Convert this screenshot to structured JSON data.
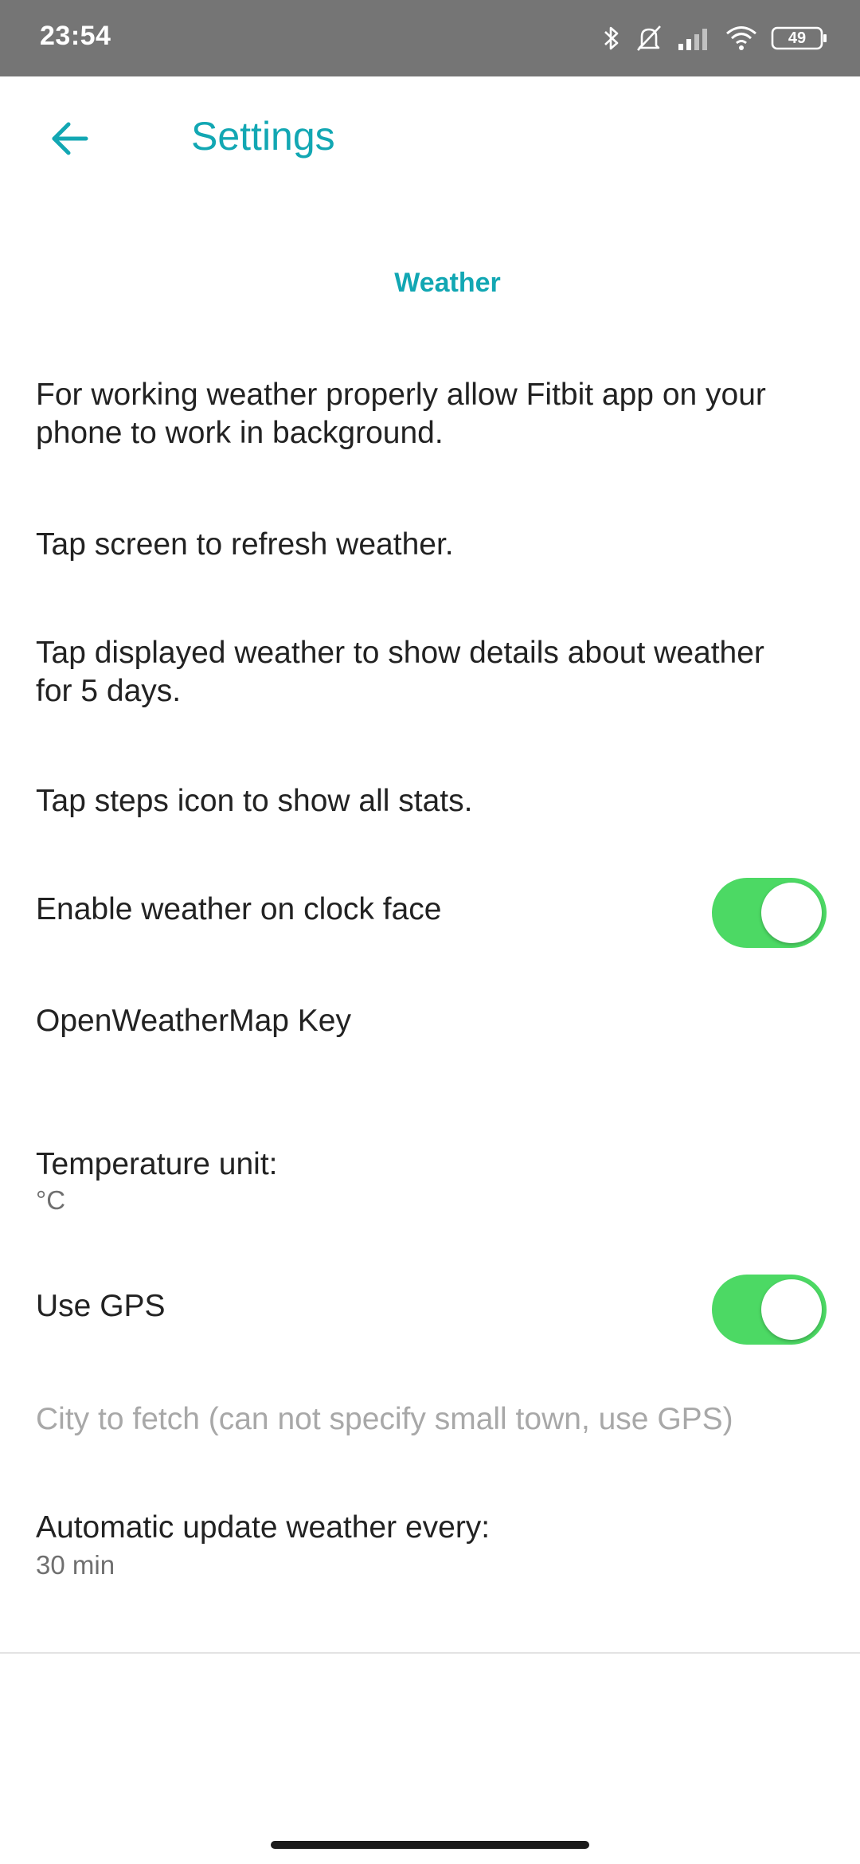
{
  "status_bar": {
    "time": "23:54",
    "battery": "49",
    "icons": [
      "bluetooth-icon",
      "bell-off-icon",
      "signal-icon",
      "wifi-icon",
      "battery-icon"
    ]
  },
  "app_bar": {
    "title": "Settings",
    "back_icon": "arrow-left-icon"
  },
  "section": {
    "title": "Weather"
  },
  "info": {
    "background": "For working weather properly allow Fitbit app on your phone to work in background.",
    "tap_refresh": "Tap screen to refresh weather.",
    "tap_details": "Tap displayed weather to show details about weather for 5 days.",
    "tap_steps": "Tap steps icon to show all stats."
  },
  "settings": {
    "enable_weather": {
      "label": "Enable weather on clock face",
      "on": true
    },
    "owm_key": {
      "label": "OpenWeatherMap Key"
    },
    "temperature_unit": {
      "label": "Temperature unit:",
      "value": "°C"
    },
    "use_gps": {
      "label": "Use GPS",
      "on": true
    },
    "city": {
      "placeholder": "City to fetch (can not specify small town, use GPS)"
    },
    "update_interval": {
      "label": "Automatic update weather every:",
      "value": "30 min"
    }
  },
  "colors": {
    "accent": "#12a7b3",
    "toggle_on": "#4cd964",
    "status_bar": "#757575"
  }
}
